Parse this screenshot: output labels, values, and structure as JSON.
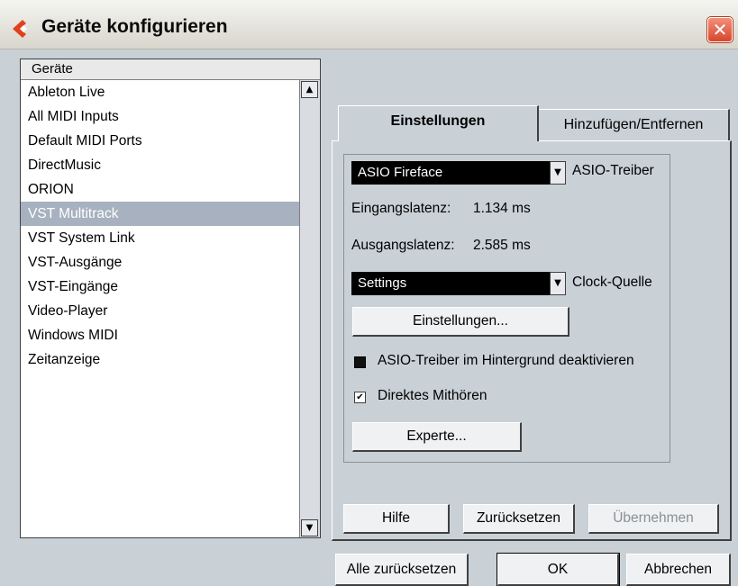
{
  "window": {
    "title": "Geräte konfigurieren",
    "close_label": "✕"
  },
  "device_list": {
    "header": "Geräte",
    "items": [
      {
        "label": "Ableton Live",
        "selected": false
      },
      {
        "label": "All MIDI Inputs",
        "selected": false
      },
      {
        "label": "Default MIDI Ports",
        "selected": false
      },
      {
        "label": "DirectMusic",
        "selected": false
      },
      {
        "label": "ORION",
        "selected": false
      },
      {
        "label": "VST Multitrack",
        "selected": true
      },
      {
        "label": "VST System Link",
        "selected": false
      },
      {
        "label": "VST-Ausgänge",
        "selected": false
      },
      {
        "label": "VST-Eingänge",
        "selected": false
      },
      {
        "label": "Video-Player",
        "selected": false
      },
      {
        "label": "Windows MIDI",
        "selected": false
      },
      {
        "label": "Zeitanzeige",
        "selected": false
      }
    ],
    "scroll_up": "▲",
    "scroll_down": "▼"
  },
  "tabs": {
    "active": "Einstellungen",
    "inactive": "Hinzufügen/Entfernen"
  },
  "settings": {
    "driver_value": "ASIO Fireface",
    "driver_label": "ASIO-Treiber",
    "input_latency_label": "Eingangslatenz:",
    "input_latency_value": "1.134 ms",
    "output_latency_label": "Ausgangslatenz:",
    "output_latency_value": "2.585 ms",
    "clock_value": "Settings",
    "clock_label": "Clock-Quelle",
    "settings_button": "Einstellungen...",
    "deactivate_label": "ASIO-Treiber im Hintergrund deaktivieren",
    "deactivate_checked": false,
    "monitoring_label": "Direktes Mithören",
    "monitoring_checked": true,
    "expert_button": "Experte...",
    "combo_arrow": "▼",
    "checkmark": "✔"
  },
  "panel_buttons": {
    "help": "Hilfe",
    "reset": "Zurücksetzen",
    "apply": "Übernehmen"
  },
  "dialog_buttons": {
    "reset_all": "Alle zurücksetzen",
    "ok": "OK",
    "cancel": "Abbrechen"
  },
  "colors": {
    "accent_red": "#e0401c",
    "selection": "#a7b1bf",
    "background": "#c9d1d7"
  }
}
